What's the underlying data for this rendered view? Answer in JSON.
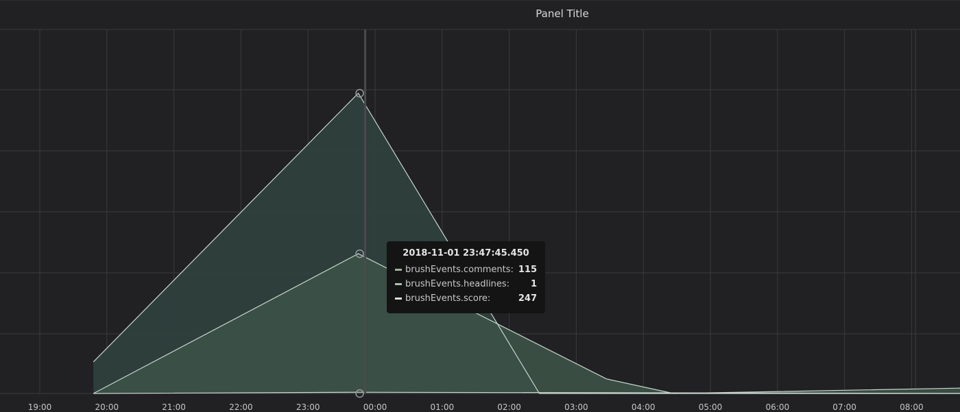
{
  "panel": {
    "title": "Panel Title"
  },
  "tooltip": {
    "time": "2018-11-01 23:47:45.450",
    "rows": [
      {
        "name": "brushEvents.comments:",
        "value": "115",
        "color": "#9fb59a"
      },
      {
        "name": "brushEvents.headlines:",
        "value": "1",
        "color": "#a8c3ad"
      },
      {
        "name": "brushEvents.score:",
        "value": "247",
        "color": "#d6e4db"
      }
    ]
  },
  "colors": {
    "background": "#212124",
    "grid": "#3a3a3c",
    "score_fill": "#2e403d",
    "comments_fill": "#3b5046",
    "line": "#c9d6cf"
  },
  "chart_data": {
    "type": "area",
    "title": "Panel Title",
    "x_tick_labels": [
      "19:00",
      "20:00",
      "21:00",
      "22:00",
      "23:00",
      "00:00",
      "01:00",
      "02:00",
      "03:00",
      "04:00",
      "05:00",
      "06:00",
      "07:00",
      "08:00"
    ],
    "x_unit": "hours since 19:00",
    "ylim": [
      0,
      250
    ],
    "grid": true,
    "series": [
      {
        "name": "brushEvents.score",
        "points": [
          [
            0.8,
            26
          ],
          [
            4.75,
            247
          ],
          [
            7.45,
            0
          ],
          [
            8.0,
            0
          ],
          [
            14.3,
            0
          ]
        ]
      },
      {
        "name": "brushEvents.comments",
        "points": [
          [
            0.8,
            0
          ],
          [
            4.75,
            115
          ],
          [
            8.45,
            12
          ],
          [
            9.45,
            0
          ],
          [
            14.3,
            5
          ]
        ]
      },
      {
        "name": "brushEvents.headlines",
        "points": [
          [
            0.8,
            0
          ],
          [
            4.75,
            1
          ],
          [
            14.3,
            0
          ]
        ]
      }
    ],
    "hover_x": 4.75
  }
}
